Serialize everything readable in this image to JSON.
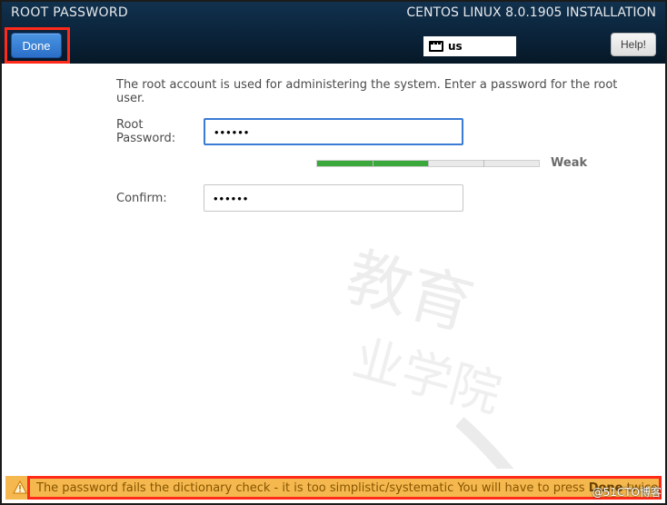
{
  "header": {
    "title": "ROOT PASSWORD",
    "install_title": "CENTOS LINUX 8.0.1905 INSTALLATION",
    "done_label": "Done",
    "help_label": "Help!",
    "keyboard_layout": "us"
  },
  "form": {
    "intro": "The root account is used for administering the system.  Enter a password for the root user.",
    "password_label": "Root Password:",
    "password_value": "••••••",
    "confirm_label": "Confirm:",
    "confirm_value": "••••••",
    "strength_label": "Weak",
    "strength_percent": 50
  },
  "warning": {
    "text_pre": "The password fails the dictionary check - it is too simplistic/systematic You will have to press ",
    "text_bold": "Done",
    "text_post": " twice to confirm."
  },
  "credit": "@51CTO博客",
  "colors": {
    "accent": "#2b6fc9",
    "warn_bg": "#f5b84e",
    "highlight": "#ff2a1a"
  }
}
